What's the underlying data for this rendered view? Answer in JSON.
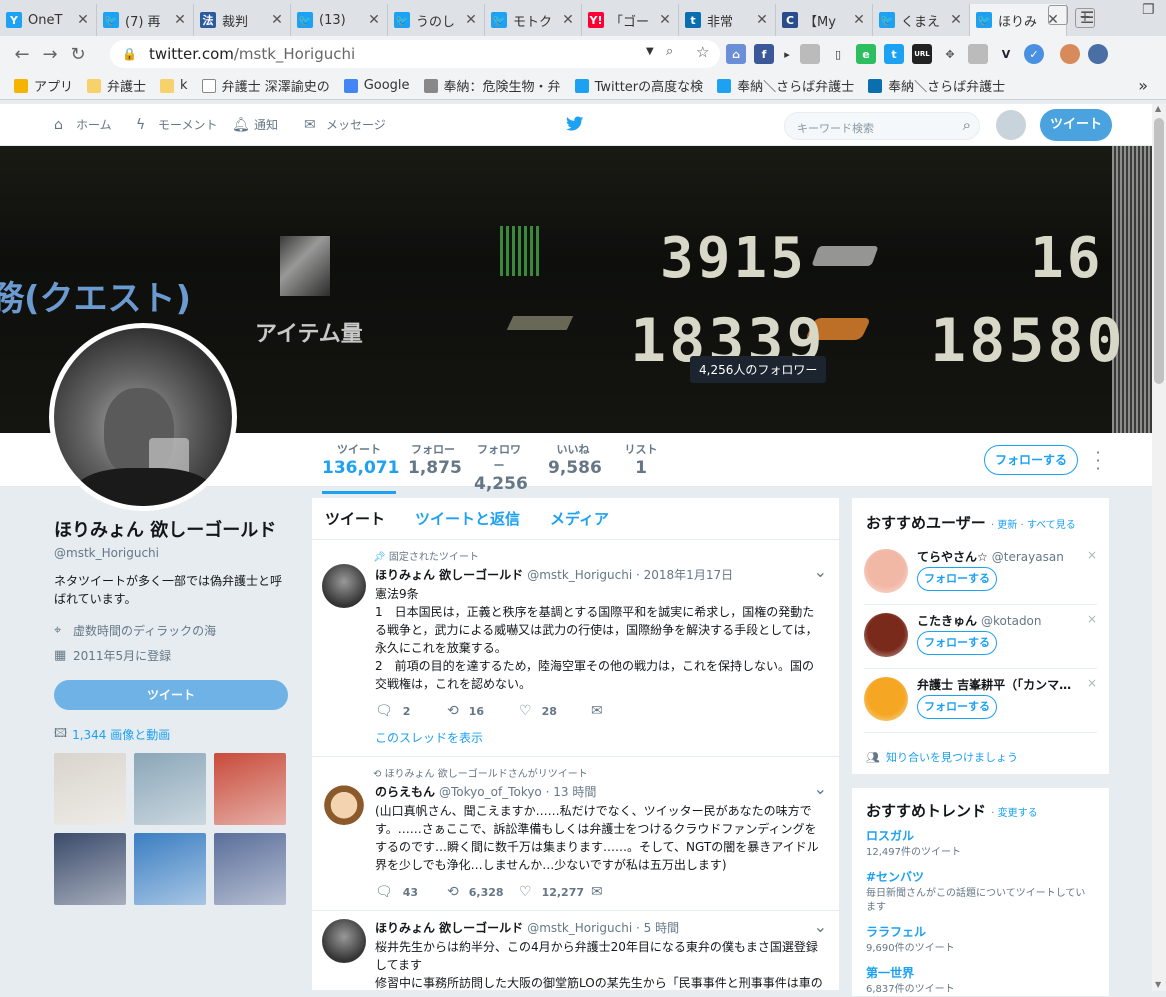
{
  "browser": {
    "tabs": [
      {
        "label": "OneT",
        "icon_color": "#1da1f2",
        "icon_char": "Y"
      },
      {
        "label": "(7) 再",
        "icon_color": "#1da1f2",
        "icon_char": "🐦"
      },
      {
        "label": "裁判",
        "icon_color": "#2c5aa0",
        "icon_char": "法"
      },
      {
        "label": "(13) ",
        "icon_color": "#1da1f2",
        "icon_char": "🐦"
      },
      {
        "label": "うのし",
        "icon_color": "#1da1f2",
        "icon_char": "🐦"
      },
      {
        "label": "モトク",
        "icon_color": "#1da1f2",
        "icon_char": "🐦"
      },
      {
        "label": "「ゴー",
        "icon_color": "#ff0033",
        "icon_char": "Y!"
      },
      {
        "label": "非常",
        "icon_color": "#0a6fb0",
        "icon_char": "t"
      },
      {
        "label": "【My",
        "icon_color": "#2b4c8c",
        "icon_char": "C"
      },
      {
        "label": "くまえ",
        "icon_color": "#1da1f2",
        "icon_char": "🐦"
      },
      {
        "label": "ほりみ",
        "icon_color": "#1da1f2",
        "icon_char": "🐦",
        "active": true
      }
    ],
    "close_glyph": "✕",
    "new_tab_glyph": "+",
    "url_host": "twitter.com",
    "url_path": "/mstk_Horiguchi",
    "bookmarks": [
      {
        "label": "アプリ",
        "color": "#f4b400"
      },
      {
        "label": "弁護士",
        "color": "#f7d26a"
      },
      {
        "label": "k",
        "color": "#f7d26a"
      },
      {
        "label": "弁護士 深澤諭史の",
        "color": "#ffffff"
      },
      {
        "label": "Google",
        "color": "#4285f4"
      },
      {
        "label": "奉納：危険生物・弁",
        "color": "#888888"
      },
      {
        "label": "Twitterの高度な検",
        "color": "#1da1f2"
      },
      {
        "label": "奉納＼さらば弁護士",
        "color": "#1da1f2"
      },
      {
        "label": "奉納＼さらば弁護士",
        "color": "#0a6fb0"
      }
    ],
    "bookmarks_more": "»"
  },
  "twitter_nav": {
    "home": "ホーム",
    "moments": "モーメント",
    "notifications": "通知",
    "messages": "メッセージ",
    "search_placeholder": "キーワード検索",
    "tweet_button": "ツイート"
  },
  "banner": {
    "numbers": [
      "3915",
      "16",
      "18339",
      "18580"
    ],
    "labels": [
      "務(クエスト)",
      "アイテム量"
    ],
    "follower_tooltip": "4,256人のフォロワー"
  },
  "profile": {
    "name": "ほりみょん 欲しーゴールド",
    "handle": "@mstk_Horiguchi",
    "bio": "ネタツイートが多く一部では偽弁護士と呼ばれています。",
    "location": "虚数時間のディラックの海",
    "joined": "2011年5月に登録",
    "tweet_button": "ツイート",
    "media_link": "1,344 画像と動画",
    "media_thumb_colors": [
      "#d9d4cc",
      "#8aa6b8",
      "#c84b3a",
      "#3a4a6a",
      "#3a7ec2",
      "#5a6e9a"
    ],
    "stats": [
      {
        "label": "ツイート",
        "value": "136,071",
        "active": true
      },
      {
        "label": "フォロー",
        "value": "1,875"
      },
      {
        "label": "フォロワー",
        "value": "4,256"
      },
      {
        "label": "いいね",
        "value": "9,586"
      },
      {
        "label": "リスト",
        "value": "1"
      }
    ],
    "follow_button": "フォローする"
  },
  "timeline": {
    "tabs": [
      "ツイート",
      "ツイートと返信",
      "メディア"
    ],
    "tweets": [
      {
        "context": "固定されたツイート",
        "name": "ほりみょん 欲しーゴールド",
        "handle": "@mstk_Horiguchi",
        "time": "2018年1月17日",
        "body": "憲法9条\n1　日本国民は，正義と秩序を基調とする国際平和を誠実に希求し，国権の発動たる戦争と，武力による威嚇又は武力の行使は，国際紛争を解決する手段としては，永久にこれを放棄する。\n2　前項の目的を達するため，陸海空軍その他の戦力は，これを保持しない。国の交戦権は，これを認めない。",
        "replies": "2",
        "retweets": "16",
        "likes": "28",
        "thread": "このスレッドを表示"
      },
      {
        "context": "ほりみょん 欲しーゴールドさんがリツイート",
        "name": "のらえもん",
        "handle": "@Tokyo_of_Tokyo",
        "time": "13 時間",
        "body": "(山口真帆さん、聞こえますか……私だけでなく、ツイッター民があなたの味方です。……さぁここで、訴訟準備もしくは弁護士をつけるクラウドファンディングをするのです…瞬く間に数千万は集まります……。そして、NGTの闇を暴きアイドル界を少しでも浄化…しませんか…少ないですが私は五万出します)",
        "replies": "43",
        "retweets": "6,328",
        "likes": "12,277"
      },
      {
        "context": "",
        "name": "ほりみょん 欲しーゴールド",
        "handle": "@mstk_Horiguchi",
        "time": "5 時間",
        "body": "桜井先生からは約半分、この4月から弁護士20年目になる東弁の僕もまさ国選登録してます\n修習中に事務所訪問した大阪の御堂筋LOの某先生から「民事事件と刑事事件は車の両輪。憲法にも書かれている弁護人の仕事をいつまでも大切に」と言われたことを今で"
      }
    ]
  },
  "who_to_follow": {
    "title": "おすすめユーザー",
    "refresh": "更新",
    "view_all": "すべて見る",
    "users": [
      {
        "name": "てらやさん☆",
        "handle": "@terayasan",
        "avatar": "#f2b8a6"
      },
      {
        "name": "こたきゅん",
        "handle": "@kotadon",
        "avatar": "#7a2a1a"
      },
      {
        "name": "弁護士 吉峯耕平（「カンマ…",
        "handle": "",
        "avatar": "#f5a623"
      }
    ],
    "follow_label": "フォローする",
    "dismiss_glyph": "×",
    "find_friends": "知り合いを見つけましょう"
  },
  "trends": {
    "title": "おすすめトレンド",
    "change": "変更する",
    "items": [
      {
        "name": "ロスガル",
        "desc": "12,497件のツイート"
      },
      {
        "name": "#センバツ",
        "desc": "毎日新聞さんがこの話題についてツイートしています"
      },
      {
        "name": "ララフェル",
        "desc": "9,690件のツイート"
      },
      {
        "name": "第一世界",
        "desc": "6,837件のツイート"
      }
    ]
  }
}
